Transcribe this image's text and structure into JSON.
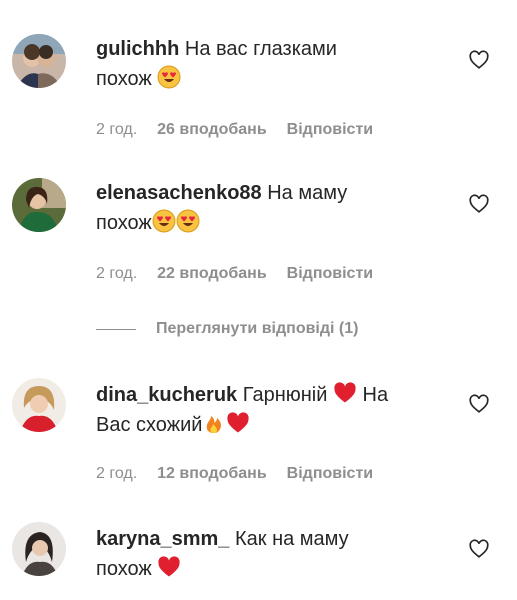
{
  "comments": [
    {
      "username": "gulichhh",
      "text_line1": "На вас глазками",
      "text_line2": "похож",
      "emojis": [
        "heart-eyes"
      ],
      "time": "2 год.",
      "likes": "26 вподобань",
      "reply": "Відповісти"
    },
    {
      "username": "elenasachenko88",
      "text_line1": "На маму",
      "text_line2": "похож",
      "emojis": [
        "heart-eyes",
        "heart-eyes"
      ],
      "time": "2 год.",
      "likes": "22 вподобань",
      "reply": "Відповісти"
    },
    {
      "username": "dina_kucheruk",
      "text_part1": "Гарнюній",
      "text_part2": "На",
      "text_line2": "Вас схожий",
      "time": "2 год.",
      "likes": "12 вподобань",
      "reply": "Відповісти"
    },
    {
      "username": "karyna_smm_",
      "text_line1": "Как на маму",
      "text_line2": "похож"
    }
  ],
  "view_replies": "Переглянути відповіді (1)",
  "colors": {
    "text": "#262626",
    "muted": "#8e8e8e",
    "heart_red": "#e0202e"
  },
  "icons": {
    "like": "heart-outline-icon",
    "emoji_heart_eyes": "heart-eyes-emoji",
    "emoji_fire": "fire-emoji",
    "emoji_red_heart": "red-heart-emoji"
  }
}
